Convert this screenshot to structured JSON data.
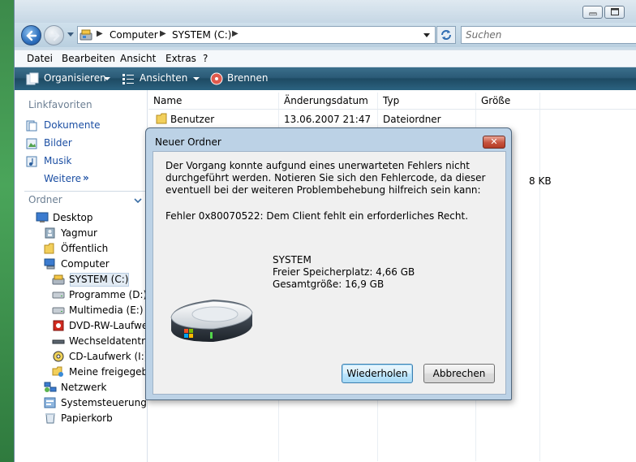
{
  "window": {
    "controls": {
      "minimize": "▭",
      "maximize": "▢"
    }
  },
  "address": {
    "crumbs": [
      "Computer",
      "SYSTEM (C:)"
    ],
    "separator": "▶",
    "search_placeholder": "Suchen"
  },
  "menubar": [
    "Datei",
    "Bearbeiten",
    "Ansicht",
    "Extras",
    "?"
  ],
  "commandbar": {
    "organize": "Organisieren",
    "views": "Ansichten",
    "burn": "Brennen"
  },
  "navpane": {
    "favorites_header": "Linkfavoriten",
    "favorites": [
      "Dokumente",
      "Bilder",
      "Musik"
    ],
    "more": "Weitere",
    "more_arrow": "»",
    "folders_header": "Ordner",
    "tree": [
      "Desktop",
      "Yagmur",
      "Öffentlich",
      "Computer",
      "SYSTEM (C:)",
      "Programme (D:)",
      "Multimedia (E:)",
      "DVD-RW-Laufwerk",
      "Wechseldatenträger",
      "CD-Laufwerk (I:) V",
      "Meine freigegebene",
      "Netzwerk",
      "Systemsteuerung",
      "Papierkorb"
    ]
  },
  "filelist": {
    "columns": [
      "Name",
      "Änderungsdatum",
      "Typ",
      "Größe"
    ],
    "rows": [
      {
        "name": "Benutzer",
        "date": "13.06.2007 21:47",
        "type": "Dateiordner",
        "size": ""
      }
    ],
    "partial_size": "8 KB"
  },
  "dialog": {
    "title": "Neuer Ordner",
    "close": "✕",
    "message": "Der Vorgang konnte aufgund eines unerwarteten Fehlers nicht durchgeführt werden. Notieren Sie sich den Fehlercode, da dieser eventuell bei der weiteren Problembehebung hilfreich sein kann:",
    "error": "Fehler 0x80070522: Dem Client fehlt ein erforderliches Recht.",
    "drive_name": "SYSTEM",
    "free_space": "Freier Speicherplatz: 4,66 GB",
    "total_size": "Gesamtgröße: 16,9 GB",
    "retry": "Wiederholen",
    "cancel": "Abbrechen"
  }
}
